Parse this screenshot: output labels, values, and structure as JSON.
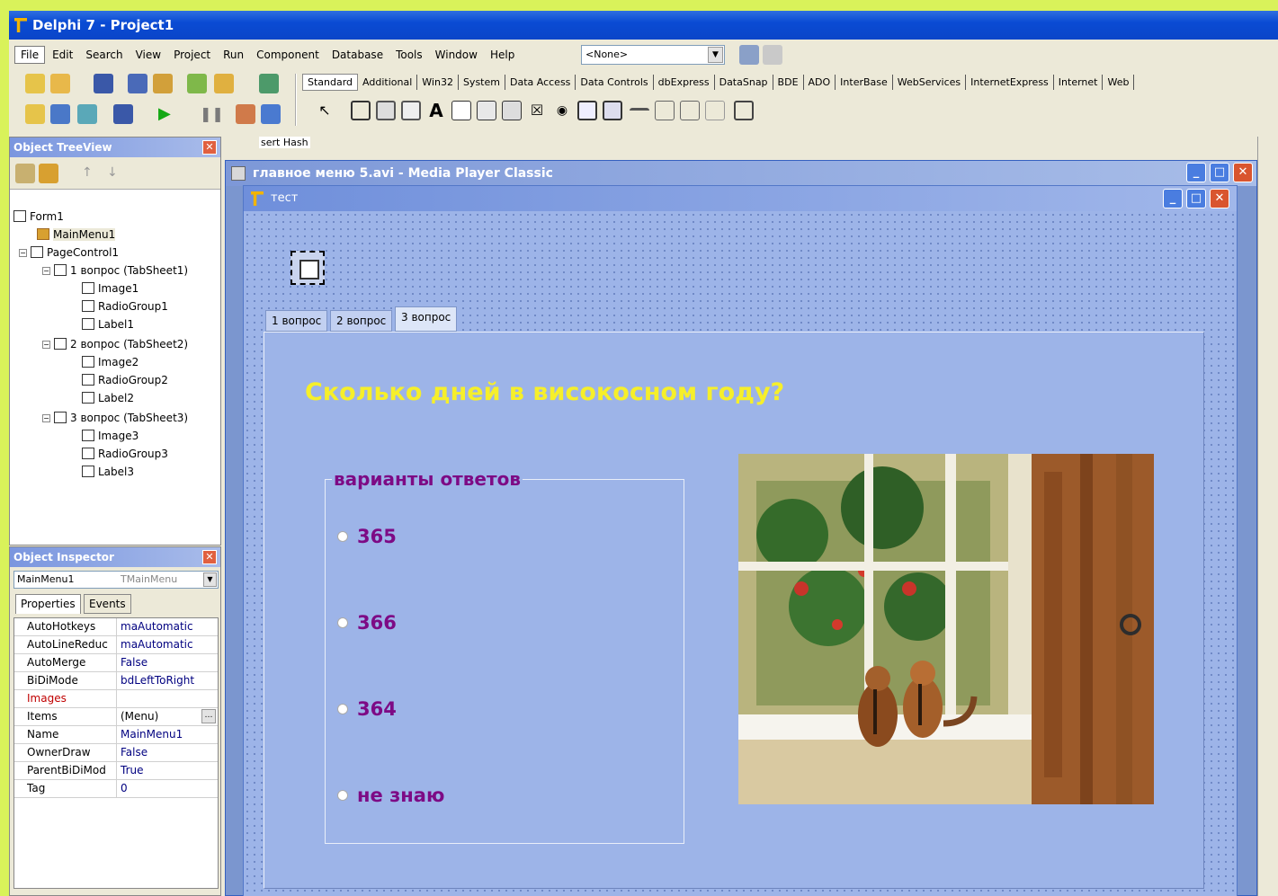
{
  "ide": {
    "title": "Delphi 7 - Project1",
    "menu": [
      "File",
      "Edit",
      "Search",
      "View",
      "Project",
      "Run",
      "Component",
      "Database",
      "Tools",
      "Window",
      "Help"
    ],
    "combo_value": "<None>",
    "palette_tabs": [
      "Standard",
      "Additional",
      "Win32",
      "System",
      "Data Access",
      "Data Controls",
      "dbExpress",
      "DataSnap",
      "BDE",
      "ADO",
      "InterBase",
      "WebServices",
      "InternetExpress",
      "Internet",
      "Web"
    ],
    "editor_fragment": "sert Hash"
  },
  "treeview": {
    "title": "Object TreeView",
    "nodes": [
      "Form1",
      "MainMenu1",
      "PageControl1",
      "1 вопрос (TabSheet1)",
      "Image1",
      "RadioGroup1",
      "Label1",
      "2 вопрос (TabSheet2)",
      "Image2",
      "RadioGroup2",
      "Label2",
      "3 вопрос (TabSheet3)",
      "Image3",
      "RadioGroup3",
      "Label3"
    ]
  },
  "inspector": {
    "title": "Object Inspector",
    "object_name": "MainMenu1",
    "object_type": "TMainMenu",
    "tabs": [
      "Properties",
      "Events"
    ],
    "properties": [
      {
        "name": "AutoHotkeys",
        "value": "maAutomatic"
      },
      {
        "name": "AutoLineReduc",
        "value": "maAutomatic"
      },
      {
        "name": "AutoMerge",
        "value": "False"
      },
      {
        "name": "BiDiMode",
        "value": "bdLeftToRight"
      },
      {
        "name": "Images",
        "value": ""
      },
      {
        "name": "Items",
        "value": "(Menu)"
      },
      {
        "name": "Name",
        "value": "MainMenu1"
      },
      {
        "name": "OwnerDraw",
        "value": "False"
      },
      {
        "name": "ParentBiDiMod",
        "value": "True"
      },
      {
        "name": "Tag",
        "value": "0"
      }
    ]
  },
  "media_player": {
    "title": "главное меню 5.avi - Media Player Classic"
  },
  "form": {
    "title": "тест",
    "tabs": [
      "1 вопрос",
      "2 вопрос",
      "3 вопрос"
    ],
    "question": "Сколько дней в високосном году?",
    "group_caption": "варианты ответов",
    "options": [
      "365",
      "366",
      "364",
      "не знаю"
    ]
  }
}
